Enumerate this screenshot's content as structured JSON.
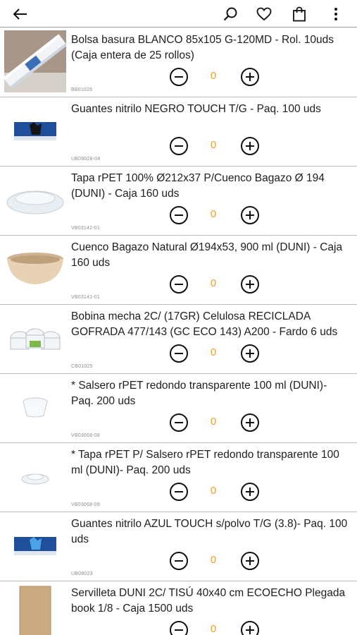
{
  "header": {
    "back_icon": "arrow-left-icon",
    "search_icon": "search-icon",
    "favorites_icon": "heart-icon",
    "cart_icon": "shopping-bag-icon",
    "more_icon": "more-vertical-icon"
  },
  "colors": {
    "quantity": "#f0a020",
    "divider": "#bdbdbd"
  },
  "products": [
    {
      "title": "Bolsa basura BLANCO 85x105 G-120MD - Rol. 10uds (Caja entera de 25 rollos)",
      "code": "BB01026",
      "quantity": "0",
      "thumb": "roll"
    },
    {
      "title": "Guantes nitrilo NEGRO TOUCH T/G - Paq. 100 uds",
      "code": "UB09028-04",
      "quantity": "0",
      "thumb": "glovebox-black"
    },
    {
      "title": "Tapa rPET 100% Ø212x37 P/Cuenco Bagazo Ø 194 (DUNI) - Caja 160 uds",
      "code": "VB03142-01",
      "quantity": "0",
      "thumb": "lid"
    },
    {
      "title": "Cuenco Bagazo Natural Ø194x53,  900 ml (DUNI) - Caja 160 uds",
      "code": "VB03141-01",
      "quantity": "0",
      "thumb": "bowl"
    },
    {
      "title": "Bobina mecha 2C/ (17GR) Celulosa RECICLADA GOFRADA 477/143 (GC ECO 143) A200 - Fardo 6 uds",
      "code": "CB01025",
      "quantity": "0",
      "thumb": "rolls"
    },
    {
      "title": "* Salsero rPET redondo transparente 100 ml (DUNI)- Paq. 200 uds",
      "code": "VB03068-08",
      "quantity": "0",
      "thumb": "cup"
    },
    {
      "title": "* Tapa rPET P/ Salsero rPET redondo transparente 100 ml (DUNI)- Paq. 200 uds",
      "code": "VB03068-09",
      "quantity": "0",
      "thumb": "small-lid"
    },
    {
      "title": "Guantes nitrilo AZUL TOUCH s/polvo T/G (3.8)- Paq. 100 uds",
      "code": "UB09023",
      "quantity": "0",
      "thumb": "glovebox-blue"
    },
    {
      "title": "Servilleta DUNI 2C/ TISÚ 40x40 cm ECOECHO Plegada book  1/8 - Caja 1500 uds",
      "code": "",
      "quantity": "0",
      "thumb": "napkin"
    }
  ]
}
